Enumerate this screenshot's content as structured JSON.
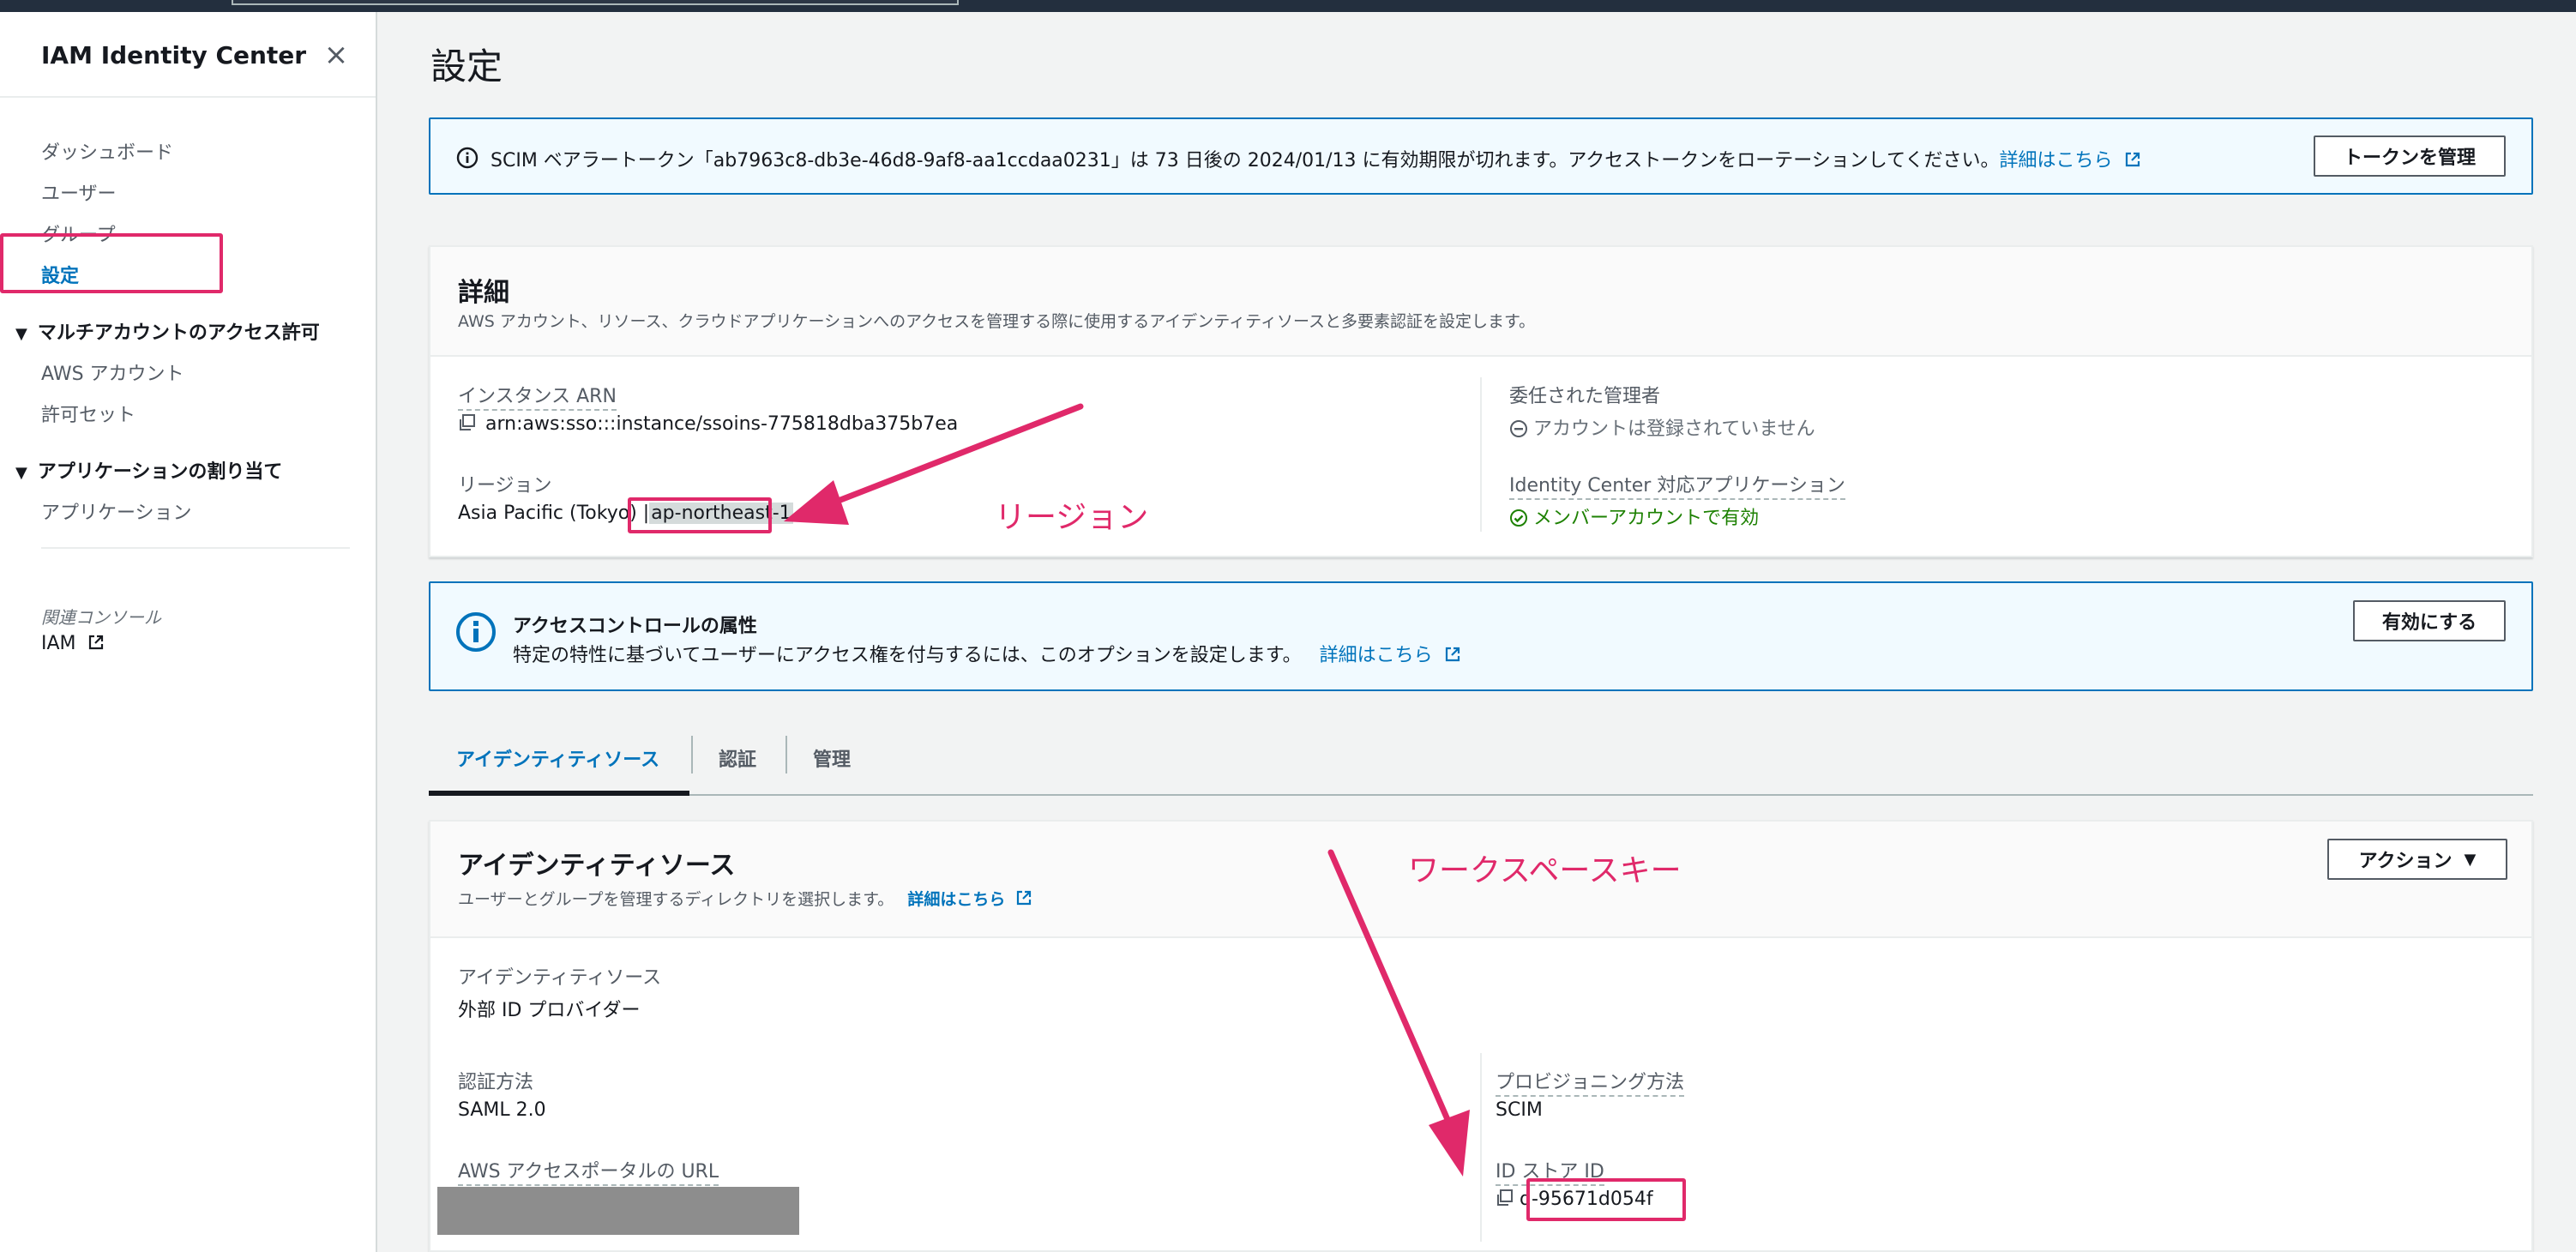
{
  "sidebar": {
    "title": "IAM Identity Center",
    "items": [
      {
        "label": "ダッシュボード"
      },
      {
        "label": "ユーザー"
      },
      {
        "label": "グループ"
      },
      {
        "label": "設定"
      }
    ],
    "section_multi": {
      "label": "マルチアカウントのアクセス許可",
      "items": [
        {
          "label": "AWS アカウント"
        },
        {
          "label": "許可セット"
        }
      ]
    },
    "section_apps": {
      "label": "アプリケーションの割り当て",
      "items": [
        {
          "label": "アプリケーション"
        }
      ]
    },
    "related_console": "関連コンソール",
    "iam_link": "IAM"
  },
  "main": {
    "title": "設定",
    "flash": {
      "text": "SCIM ベアラートークン「ab7963c8-db3e-46d8-9af8-aa1ccdaa0231」は 73 日後の 2024/01/13 に有効期限が切れます。アクセストークンをローテーションしてください。",
      "link": "詳細はこちら",
      "button": "トークンを管理"
    },
    "details": {
      "title": "詳細",
      "description": "AWS アカウント、リソース、クラウドアプリケーションへのアクセスを管理する際に使用するアイデンティティソースと多要素認証を設定します。",
      "instance_arn_label": "インスタンス ARN",
      "instance_arn_value": "arn:aws:sso:::instance/ssoins-775818dba375b7ea",
      "region_label": "リージョン",
      "region_name": "Asia Pacific (Tokyo) |",
      "region_code": "ap-northeast-1",
      "delegated_admin_label": "委任された管理者",
      "delegated_admin_value": "アカウントは登録されていません",
      "apps_label": "Identity Center 対応アプリケーション",
      "apps_value": "メンバーアカウントで有効"
    },
    "annotations": {
      "region": "リージョン",
      "workspace_key": "ワークスペースキー"
    },
    "abac": {
      "title": "アクセスコントロールの属性",
      "text": "特定の特性に基づいてユーザーにアクセス権を付与するには、このオプションを設定します。",
      "link": "詳細はこちら",
      "button": "有効にする"
    },
    "tabs": [
      {
        "label": "アイデンティティソース"
      },
      {
        "label": "認証"
      },
      {
        "label": "管理"
      }
    ],
    "identity_source": {
      "title": "アイデンティティソース",
      "description": "ユーザーとグループを管理するディレクトリを選択します。",
      "link": "詳細はこちら",
      "action_button": "アクション",
      "source_label": "アイデンティティソース",
      "source_value": "外部 ID プロバイダー",
      "auth_label": "認証方法",
      "auth_value": "SAML 2.0",
      "portal_label": "AWS アクセスポータルの URL",
      "provisioning_label": "プロビジョニング方法",
      "provisioning_value": "SCIM",
      "store_id_label": "ID ストア ID",
      "store_id_value": "d-95671d054f"
    }
  },
  "colors": {
    "accent": "#0073bb",
    "annotation": "#e0296a",
    "success": "#1d8102",
    "nav_dark": "#232f3e"
  }
}
